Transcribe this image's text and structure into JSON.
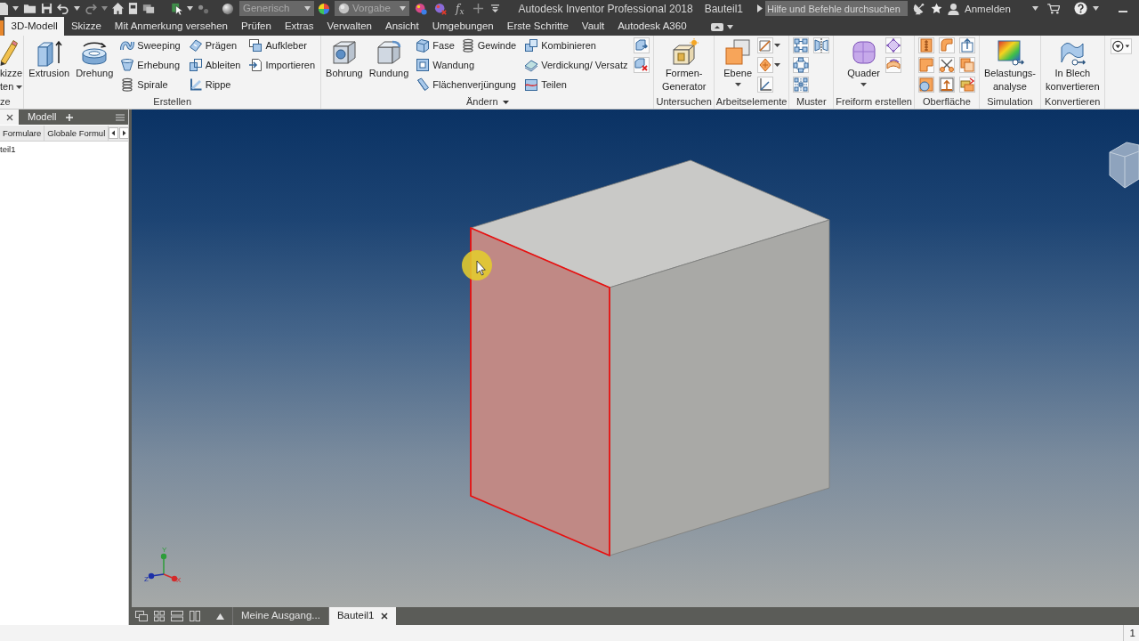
{
  "title_bar": {
    "appearance": [
      {
        "value": "Generisch",
        "disabled": true
      },
      {
        "value": "Vorgabe",
        "disabled": true
      }
    ],
    "formula": "f$_{x}$",
    "title": "Autodesk Inventor Professional 2018",
    "document": "Bauteil1",
    "search": {
      "placeholder": "Hilfe und Befehle durchsuchen"
    },
    "sign_in": "Anmelden"
  },
  "ribbon_tabs": [
    {
      "label": "3D-Modell",
      "selected": true
    },
    {
      "label": "Skizze",
      "selected": false
    },
    {
      "label": "Mit Anmerkung versehen",
      "selected": false
    },
    {
      "label": "Prüfen",
      "selected": false
    },
    {
      "label": "Extras",
      "selected": false
    },
    {
      "label": "Verwalten",
      "selected": false
    },
    {
      "label": "Ansicht",
      "selected": false
    },
    {
      "label": "Umgebungen",
      "selected": false
    },
    {
      "label": "Erste Schritte",
      "selected": false
    },
    {
      "label": "Vault",
      "selected": false
    },
    {
      "label": "Autodesk A360",
      "selected": false
    }
  ],
  "ribbon_groups": [
    {
      "label": "ze",
      "dropdown": false,
      "columns": [
        [
          [
            {
              "kind": "large",
              "label": "kizze\nten",
              "dropdown": true
            }
          ]
        ]
      ]
    },
    {
      "label": "Erstellen",
      "dropdown": false,
      "columns": [
        [
          [
            {
              "kind": "large",
              "label": "Extrusion",
              "dropdown": false
            }
          ]
        ],
        [
          [
            {
              "kind": "large",
              "label": "Drehung",
              "dropdown": false
            }
          ]
        ],
        [
          [
            {
              "kind": "small",
              "label": "Sweeping",
              "dropdown": false
            }
          ],
          [
            {
              "kind": "small",
              "label": "Erhebung",
              "dropdown": false
            }
          ],
          [
            {
              "kind": "small",
              "label": "Spirale",
              "dropdown": false
            }
          ]
        ],
        [
          [
            {
              "kind": "small",
              "label": "Prägen",
              "dropdown": false
            }
          ],
          [
            {
              "kind": "small",
              "label": "Ableiten",
              "dropdown": false
            }
          ],
          [
            {
              "kind": "small",
              "label": "Rippe",
              "dropdown": false
            }
          ]
        ],
        [
          [
            {
              "kind": "small",
              "label": "Aufkleber",
              "dropdown": false
            }
          ],
          [
            {
              "kind": "small",
              "label": "Importieren",
              "dropdown": false
            }
          ]
        ]
      ]
    },
    {
      "label": "Ändern",
      "dropdown": true,
      "columns": [
        [
          [
            {
              "kind": "large",
              "label": "Bohrung",
              "dropdown": false
            }
          ]
        ],
        [
          [
            {
              "kind": "large",
              "label": "Rundung",
              "dropdown": false
            }
          ]
        ],
        [
          [
            {
              "kind": "small",
              "label": "Fase",
              "dropdown": false
            },
            {
              "kind": "small",
              "label": "Gewinde",
              "dropdown": false
            }
          ],
          [
            {
              "kind": "small",
              "label": "Wandung",
              "dropdown": false
            }
          ],
          [
            {
              "kind": "small",
              "label": "Flächenverjüngung",
              "dropdown": false
            }
          ]
        ],
        [
          [
            {
              "kind": "small",
              "label": "Kombinieren",
              "dropdown": false
            }
          ],
          [
            {
              "kind": "small",
              "label": "Verdickung/ Versatz",
              "dropdown": false
            }
          ],
          [
            {
              "kind": "small",
              "label": "Teilen",
              "dropdown": false
            }
          ]
        ],
        [
          [
            {
              "kind": "icon",
              "dropdown": false
            }
          ],
          [
            {
              "kind": "icon",
              "dropdown": false
            }
          ]
        ]
      ]
    },
    {
      "label": "Untersuchen",
      "dropdown": false,
      "columns": [
        [
          [
            {
              "kind": "large",
              "label": "Formen-\nGenerator",
              "dropdown": false
            }
          ]
        ]
      ]
    },
    {
      "label": "Arbeitselemente",
      "dropdown": false,
      "columns": [
        [
          [
            {
              "kind": "large",
              "label": "Ebene",
              "dropdown": true
            }
          ]
        ],
        [
          [
            {
              "kind": "icon",
              "dropdown": true
            }
          ],
          [
            {
              "kind": "icon",
              "dropdown": true
            }
          ],
          [
            {
              "kind": "icon",
              "dropdown": false
            }
          ]
        ]
      ]
    },
    {
      "label": "Muster",
      "dropdown": false,
      "columns": [
        [
          [
            {
              "kind": "icon",
              "dropdown": false
            }
          ],
          [
            {
              "kind": "icon",
              "dropdown": false
            }
          ],
          [
            {
              "kind": "icon",
              "dropdown": false
            }
          ]
        ],
        [
          [
            {
              "kind": "icon",
              "dropdown": false
            }
          ]
        ]
      ]
    },
    {
      "label": "Freiform erstellen",
      "dropdown": false,
      "columns": [
        [
          [
            {
              "kind": "large",
              "label": "Quader",
              "dropdown": true
            }
          ]
        ],
        [
          [
            {
              "kind": "icon",
              "dropdown": false
            }
          ],
          [
            {
              "kind": "icon",
              "dropdown": false
            }
          ]
        ]
      ]
    },
    {
      "label": "Oberfläche",
      "dropdown": false,
      "columns": [
        [
          [
            {
              "kind": "icon",
              "dropdown": false
            }
          ],
          [
            {
              "kind": "icon",
              "dropdown": false
            }
          ],
          [
            {
              "kind": "icon",
              "dropdown": false
            }
          ]
        ],
        [
          [
            {
              "kind": "icon",
              "dropdown": false
            }
          ],
          [
            {
              "kind": "icon",
              "dropdown": false
            }
          ],
          [
            {
              "kind": "icon",
              "dropdown": false
            }
          ]
        ],
        [
          [
            {
              "kind": "icon",
              "dropdown": false
            }
          ],
          [
            {
              "kind": "icon",
              "dropdown": false
            }
          ],
          [
            {
              "kind": "icon",
              "dropdown": false
            }
          ]
        ]
      ]
    },
    {
      "label": "Simulation",
      "dropdown": false,
      "columns": [
        [
          [
            {
              "kind": "large",
              "label": "Belastungs-\nanalyse",
              "dropdown": false
            }
          ]
        ]
      ]
    },
    {
      "label": "Konvertieren",
      "dropdown": false,
      "columns": [
        [
          [
            {
              "kind": "large",
              "label": "In Blech\nkonvertieren",
              "dropdown": false
            }
          ]
        ]
      ]
    }
  ],
  "browser": {
    "title": "Modell",
    "tabs": [
      {
        "label": "Formulare",
        "selected": false
      },
      {
        "label": "Globale Formul",
        "selected": false
      }
    ],
    "items": [
      {
        "label": "teil1"
      }
    ]
  },
  "viewport": {
    "faces": [
      {
        "selected": false
      },
      {
        "selected": false
      },
      {
        "selected": true
      }
    ],
    "triad": [
      {
        "label": "Y",
        "color": "#2e9d3a"
      },
      {
        "label": "Z",
        "color": "#1b2fa8"
      },
      {
        "label": "X",
        "color": "#d42a2a"
      }
    ]
  },
  "document_tabs": [
    {
      "label": "Meine Ausgang...",
      "selected": false
    },
    {
      "label": "Bauteil1",
      "selected": true
    }
  ],
  "status_bar": {
    "value": "1"
  }
}
